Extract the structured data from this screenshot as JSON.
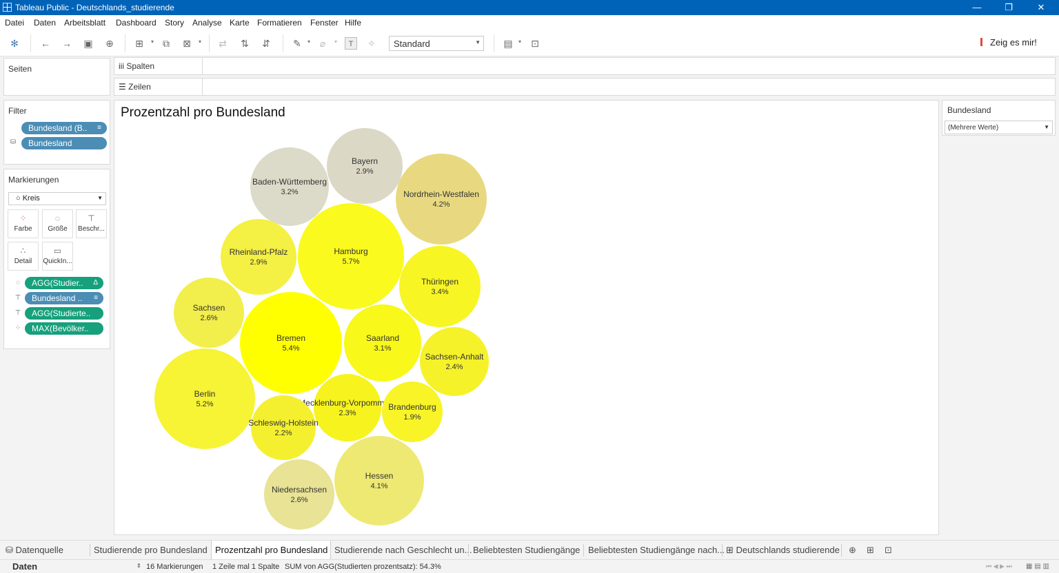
{
  "window": {
    "title": "Tableau Public - Deutschlands_studierende"
  },
  "menu": [
    "Datei",
    "Daten",
    "Arbeitsblatt",
    "Dashboard",
    "Story",
    "Analyse",
    "Karte",
    "Formatieren",
    "Fenster",
    "Hilfe"
  ],
  "toolbar": {
    "view_select": "Standard",
    "show_me": "Zeig es mir!"
  },
  "panels": {
    "pages": "Seiten",
    "filter": {
      "title": "Filter",
      "pills": [
        "Bundesland (B..",
        "Bundesland"
      ]
    },
    "marks": {
      "title": "Markierungen",
      "mark_type": "Kreis",
      "buttons": [
        "Farbe",
        "Größe",
        "Beschr...",
        "Detail",
        "QuickIn..."
      ],
      "fields": [
        "AGG(Studier..",
        "Bundesland ..",
        "AGG(Studierte..",
        "MAX(Bevölker.."
      ]
    }
  },
  "shelves": {
    "columns": "Spalten",
    "rows": "Zeilen"
  },
  "viz": {
    "title": "Prozentzahl pro Bundesland"
  },
  "legend": {
    "title": "Bundesland",
    "value": "(Mehrere Werte)"
  },
  "chart_data": {
    "type": "bubble",
    "title": "Prozentzahl pro Bundesland",
    "items": [
      {
        "label": "Bayern",
        "value": "2.9%",
        "pct": 2.9,
        "color": "#dcd8c6"
      },
      {
        "label": "Baden-Württemberg",
        "value": "3.2%",
        "pct": 3.2,
        "color": "#dcdbc9"
      },
      {
        "label": "Nordrhein-Westfalen",
        "value": "4.2%",
        "pct": 4.2,
        "color": "#e8d980"
      },
      {
        "label": "Hamburg",
        "value": "5.7%",
        "pct": 5.7,
        "color": "#fafa1e"
      },
      {
        "label": "Rheinland-Pfalz",
        "value": "2.9%",
        "pct": 2.9,
        "color": "#f4f044"
      },
      {
        "label": "Thüringen",
        "value": "3.4%",
        "pct": 3.4,
        "color": "#f8f524"
      },
      {
        "label": "Sachsen",
        "value": "2.6%",
        "pct": 2.6,
        "color": "#f2ee4c"
      },
      {
        "label": "Bremen",
        "value": "5.4%",
        "pct": 5.4,
        "color": "#ffff00"
      },
      {
        "label": "Saarland",
        "value": "3.1%",
        "pct": 3.1,
        "color": "#f8f81a"
      },
      {
        "label": "Sachsen-Anhalt",
        "value": "2.4%",
        "pct": 2.4,
        "color": "#f6f22a"
      },
      {
        "label": "Berlin",
        "value": "5.2%",
        "pct": 5.2,
        "color": "#f7f335"
      },
      {
        "label": "Mecklenburg-Vorpommern",
        "value": "2.3%",
        "pct": 2.3,
        "color": "#f7f31e"
      },
      {
        "label": "Brandenburg",
        "value": "1.9%",
        "pct": 1.9,
        "color": "#f8f428"
      },
      {
        "label": "Schleswig-Holstein",
        "value": "2.2%",
        "pct": 2.2,
        "color": "#f4f030"
      },
      {
        "label": "Niedersachsen",
        "value": "2.6%",
        "pct": 2.6,
        "color": "#e8e395"
      },
      {
        "label": "Hessen",
        "value": "4.1%",
        "pct": 4.1,
        "color": "#ede973"
      }
    ]
  },
  "tabs": [
    "Datenquelle",
    "Studierende pro Bundesland",
    "Prozentzahl pro Bundesland",
    "Studierende nach Geschlecht un...",
    "Beliebtesten Studiengänge",
    "Beliebtesten Studiengänge nach...",
    "Deutschlands studierende"
  ],
  "status": {
    "section": "Daten",
    "marks": "16 Markierungen",
    "rows_cols": "1 Zeile mal 1 Spalte",
    "sum": "SUM von AGG(Studierten prozentsatz): 54.3%"
  }
}
